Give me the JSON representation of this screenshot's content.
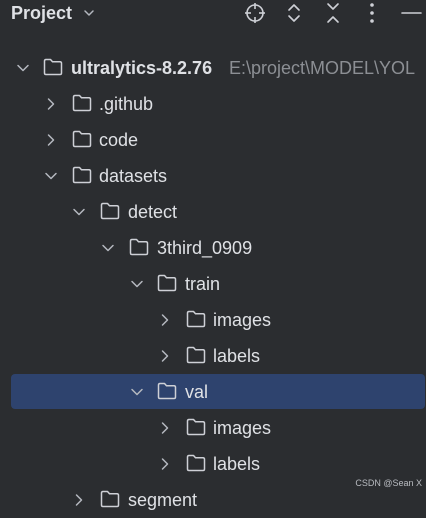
{
  "header": {
    "title": "Project"
  },
  "root": {
    "name": "ultralytics-8.2.76",
    "path": "E:\\project\\MODEL\\YOL"
  },
  "tree": [
    {
      "name": ".github",
      "expanded": false
    },
    {
      "name": "code",
      "expanded": false
    },
    {
      "name": "datasets",
      "expanded": true
    },
    {
      "name": "detect",
      "expanded": true
    },
    {
      "name": "3third_0909",
      "expanded": true
    },
    {
      "name": "train",
      "expanded": true
    },
    {
      "name": "images",
      "expanded": false
    },
    {
      "name": "labels",
      "expanded": false
    },
    {
      "name": "val",
      "expanded": true,
      "selected": true
    },
    {
      "name": "images",
      "expanded": false
    },
    {
      "name": "labels",
      "expanded": false
    },
    {
      "name": "segment",
      "expanded": false
    }
  ],
  "watermark": "CSDN @Sean X",
  "colors": {
    "background": "#2B2D30",
    "selection": "#2E436E",
    "text": "#DFE1E5",
    "muted": "#8C8F94"
  },
  "icons": {
    "locate": "crosshair-icon",
    "expand_all": "expand-all-icon",
    "collapse_all": "collapse-all-icon",
    "options": "more-vertical-icon",
    "hide": "minimize-icon"
  }
}
